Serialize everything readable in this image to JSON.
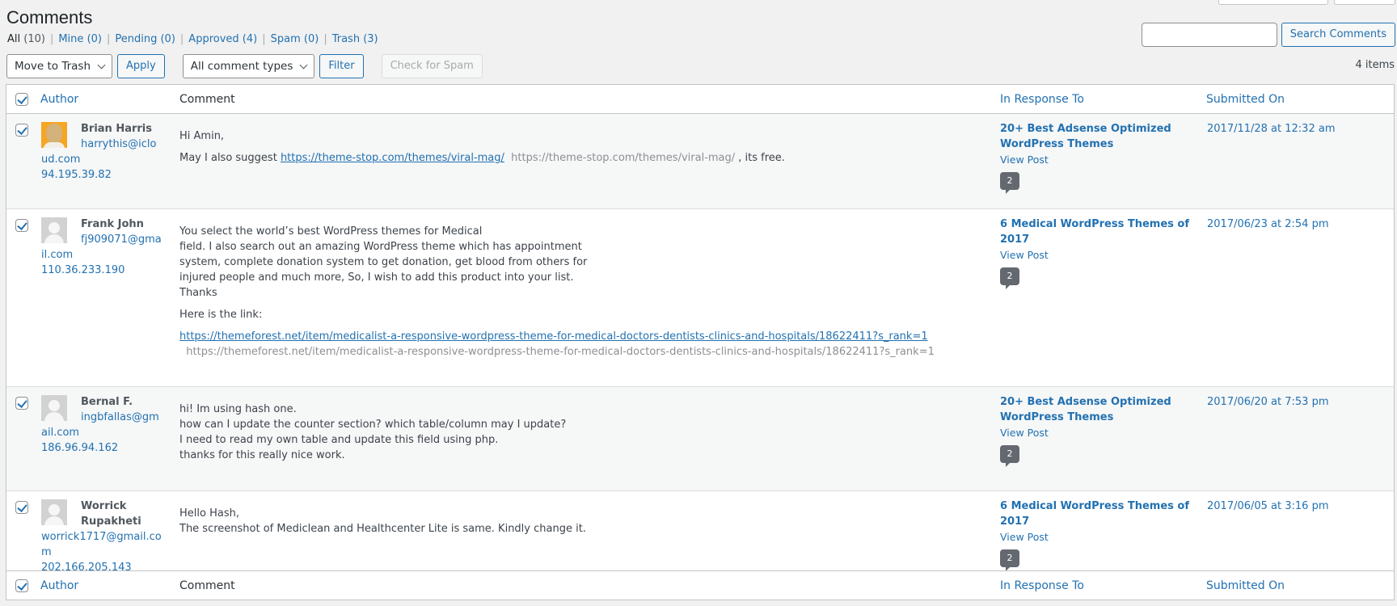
{
  "page": {
    "title": "Comments"
  },
  "filters": [
    {
      "label": "All",
      "count": "(10)",
      "current": true
    },
    {
      "label": "Mine",
      "count": "(0)"
    },
    {
      "label": "Pending",
      "count": "(0)"
    },
    {
      "label": "Approved",
      "count": "(4)"
    },
    {
      "label": "Spam",
      "count": "(0)"
    },
    {
      "label": "Trash",
      "count": "(3)"
    }
  ],
  "search": {
    "value": "",
    "placeholder": "",
    "button_label": "Search Comments"
  },
  "tablenav": {
    "bulk_action": "Move to Trash",
    "apply_label": "Apply",
    "comment_type": "All comment types",
    "filter_label": "Filter",
    "check_spam_label": "Check for Spam",
    "items_count": "4 items"
  },
  "columns": {
    "author": "Author",
    "comment": "Comment",
    "in_response_to": "In Response To",
    "submitted_on": "Submitted On"
  },
  "comments": [
    {
      "author": "Brian Harris",
      "email": "harrythis@icloud.com",
      "ip": "94.195.39.82",
      "avatar": "custom-avatar",
      "paragraphs": [
        "Hi Amin,"
      ],
      "suggest_prefix": "May I also suggest ",
      "suggest_link": "https://theme-stop.com/themes/viral-mag/",
      "suggest_plain": "https://theme-stop.com/themes/viral-mag/",
      "suggest_suffix": " , its free.",
      "post_title": "20+ Best Adsense Optimized WordPress Themes",
      "view_post": "View Post",
      "comment_count": "2",
      "date": "2017/11/28 at 12:32 am"
    },
    {
      "author": "Frank John",
      "email": "fj909071@gmail.com",
      "ip": "110.36.233.190",
      "avatar": "mystery-man",
      "body_lines": [
        "You select the world’s best WordPress themes for Medical",
        "field. I also search out an amazing WordPress theme which has appointment",
        "system, complete donation system to get donation, get blood from others for",
        "injured people and much more, So, I wish to add this product into your list.",
        "Thanks"
      ],
      "link_intro": "Here is the link:",
      "link": "https://themeforest.net/item/medicalist-a-responsive-wordpress-theme-for-medical-doctors-dentists-clinics-and-hospitals/18622411?s_rank=1",
      "link_plain": "https://themeforest.net/item/medicalist-a-responsive-wordpress-theme-for-medical-doctors-dentists-clinics-and-hospitals/18622411?s_rank=1",
      "post_title": "6 Medical WordPress Themes of 2017",
      "view_post": "View Post",
      "comment_count": "2",
      "date": "2017/06/23 at 2:54 pm"
    },
    {
      "author": "Bernal F.",
      "email": "ingbfallas@gmail.com",
      "ip": "186.96.94.162",
      "avatar": "mystery-man",
      "body_lines": [
        "hi! Im using hash one.",
        "how can I update the counter section? which table/column may I update?",
        "I need to read my own table and update this field using php.",
        "thanks for this really nice work."
      ],
      "post_title": "20+ Best Adsense Optimized WordPress Themes",
      "view_post": "View Post",
      "comment_count": "2",
      "date": "2017/06/20 at 7:53 pm"
    },
    {
      "author": "Worrick Rupakheti",
      "email": "worrick1717@gmail.com",
      "ip": "202.166.205.143",
      "avatar": "mystery-man",
      "body_lines": [
        "Hello Hash,",
        "The screenshot of Mediclean and Healthcenter Lite is same. Kindly change it."
      ],
      "post_title": "6 Medical WordPress Themes of 2017",
      "view_post": "View Post",
      "comment_count": "2",
      "date": "2017/06/05 at 3:16 pm"
    }
  ]
}
